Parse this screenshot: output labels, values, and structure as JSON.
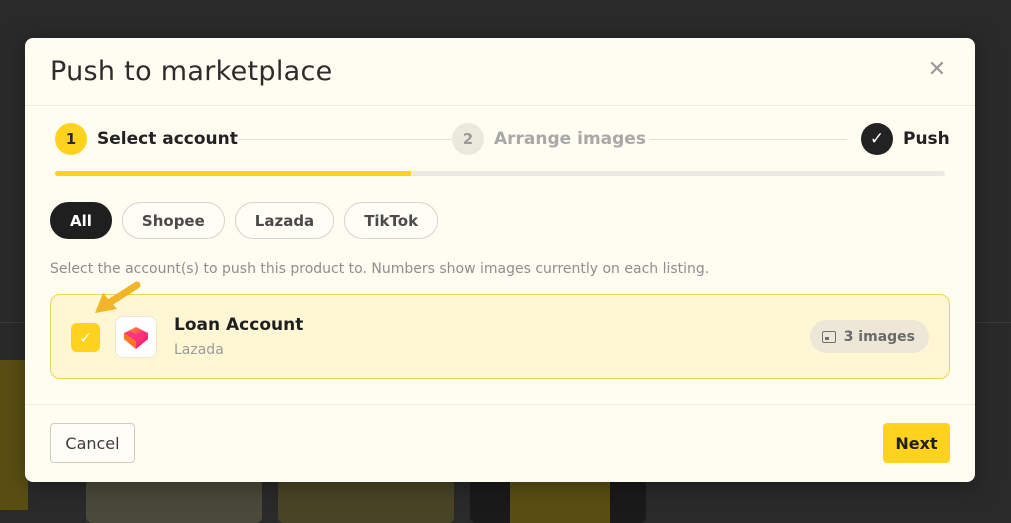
{
  "modal": {
    "title": "Push to marketplace",
    "close_icon": "close-icon"
  },
  "stepper": {
    "steps": [
      {
        "number": "1",
        "label": "Select account",
        "state": "active"
      },
      {
        "number": "2",
        "label": "Arrange images",
        "state": "inactive"
      },
      {
        "number": "✓",
        "label": "Push",
        "state": "done"
      }
    ],
    "progress_percent": 40
  },
  "filters": {
    "tabs": [
      {
        "label": "All",
        "active": true
      },
      {
        "label": "Shopee",
        "active": false
      },
      {
        "label": "Lazada",
        "active": false
      },
      {
        "label": "TikTok",
        "active": false
      }
    ]
  },
  "helper_text": "Select the account(s) to push this product to. Numbers show images currently on each listing.",
  "accounts": [
    {
      "name": "Loan Account",
      "platform": "Lazada",
      "images_label": "3 images",
      "checked": true,
      "checkbox_mark": "✓"
    }
  ],
  "footer": {
    "cancel_label": "Cancel",
    "next_label": "Next"
  },
  "colors": {
    "accent": "#ffd21e",
    "dark": "#1f1f1f",
    "arrow": "#f2b527"
  }
}
